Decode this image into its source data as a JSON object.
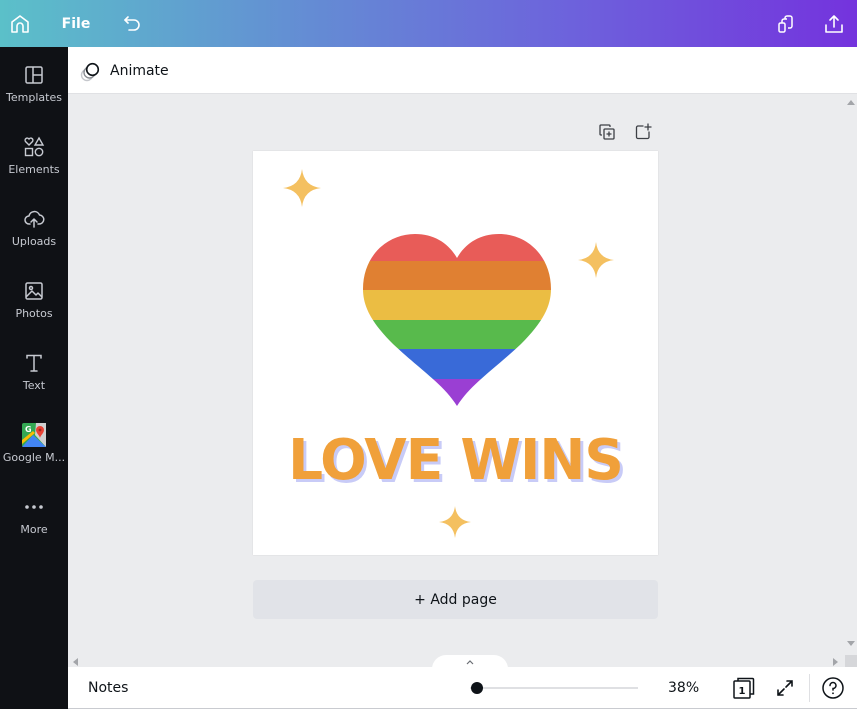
{
  "topbar": {
    "home_icon": "home-icon",
    "file_label": "File",
    "undo_icon": "undo-icon",
    "resize_icon": "copy-pages-icon",
    "share_icon": "share-upload-icon",
    "gradient_colors": [
      "#5bc0c9",
      "#6390d3",
      "#6d62dc",
      "#7433dd"
    ]
  },
  "sidebar": {
    "items": [
      {
        "label": "Templates",
        "icon": "templates-icon"
      },
      {
        "label": "Elements",
        "icon": "elements-icon"
      },
      {
        "label": "Uploads",
        "icon": "uploads-icon"
      },
      {
        "label": "Photos",
        "icon": "photos-icon"
      },
      {
        "label": "Text",
        "icon": "text-icon"
      },
      {
        "label": "Google M...",
        "icon": "google-maps-icon"
      },
      {
        "label": "More",
        "icon": "more-icon"
      }
    ]
  },
  "animate_bar": {
    "label": "Animate"
  },
  "page": {
    "title_text": "LOVE WINS",
    "text_color": "#f0a03a",
    "shadow_color": "#c8cbf7",
    "heart_stripes": [
      "#e85c58",
      "#e08032",
      "#ebbd43",
      "#58ba4c",
      "#396ad8",
      "#9a3fd3"
    ],
    "sparkle_color": "#f4c060"
  },
  "add_page": {
    "label": "+ Add page"
  },
  "bottombar": {
    "notes_label": "Notes",
    "zoom_value": "38%",
    "zoom_fraction": 0.04,
    "page_count": "1"
  }
}
